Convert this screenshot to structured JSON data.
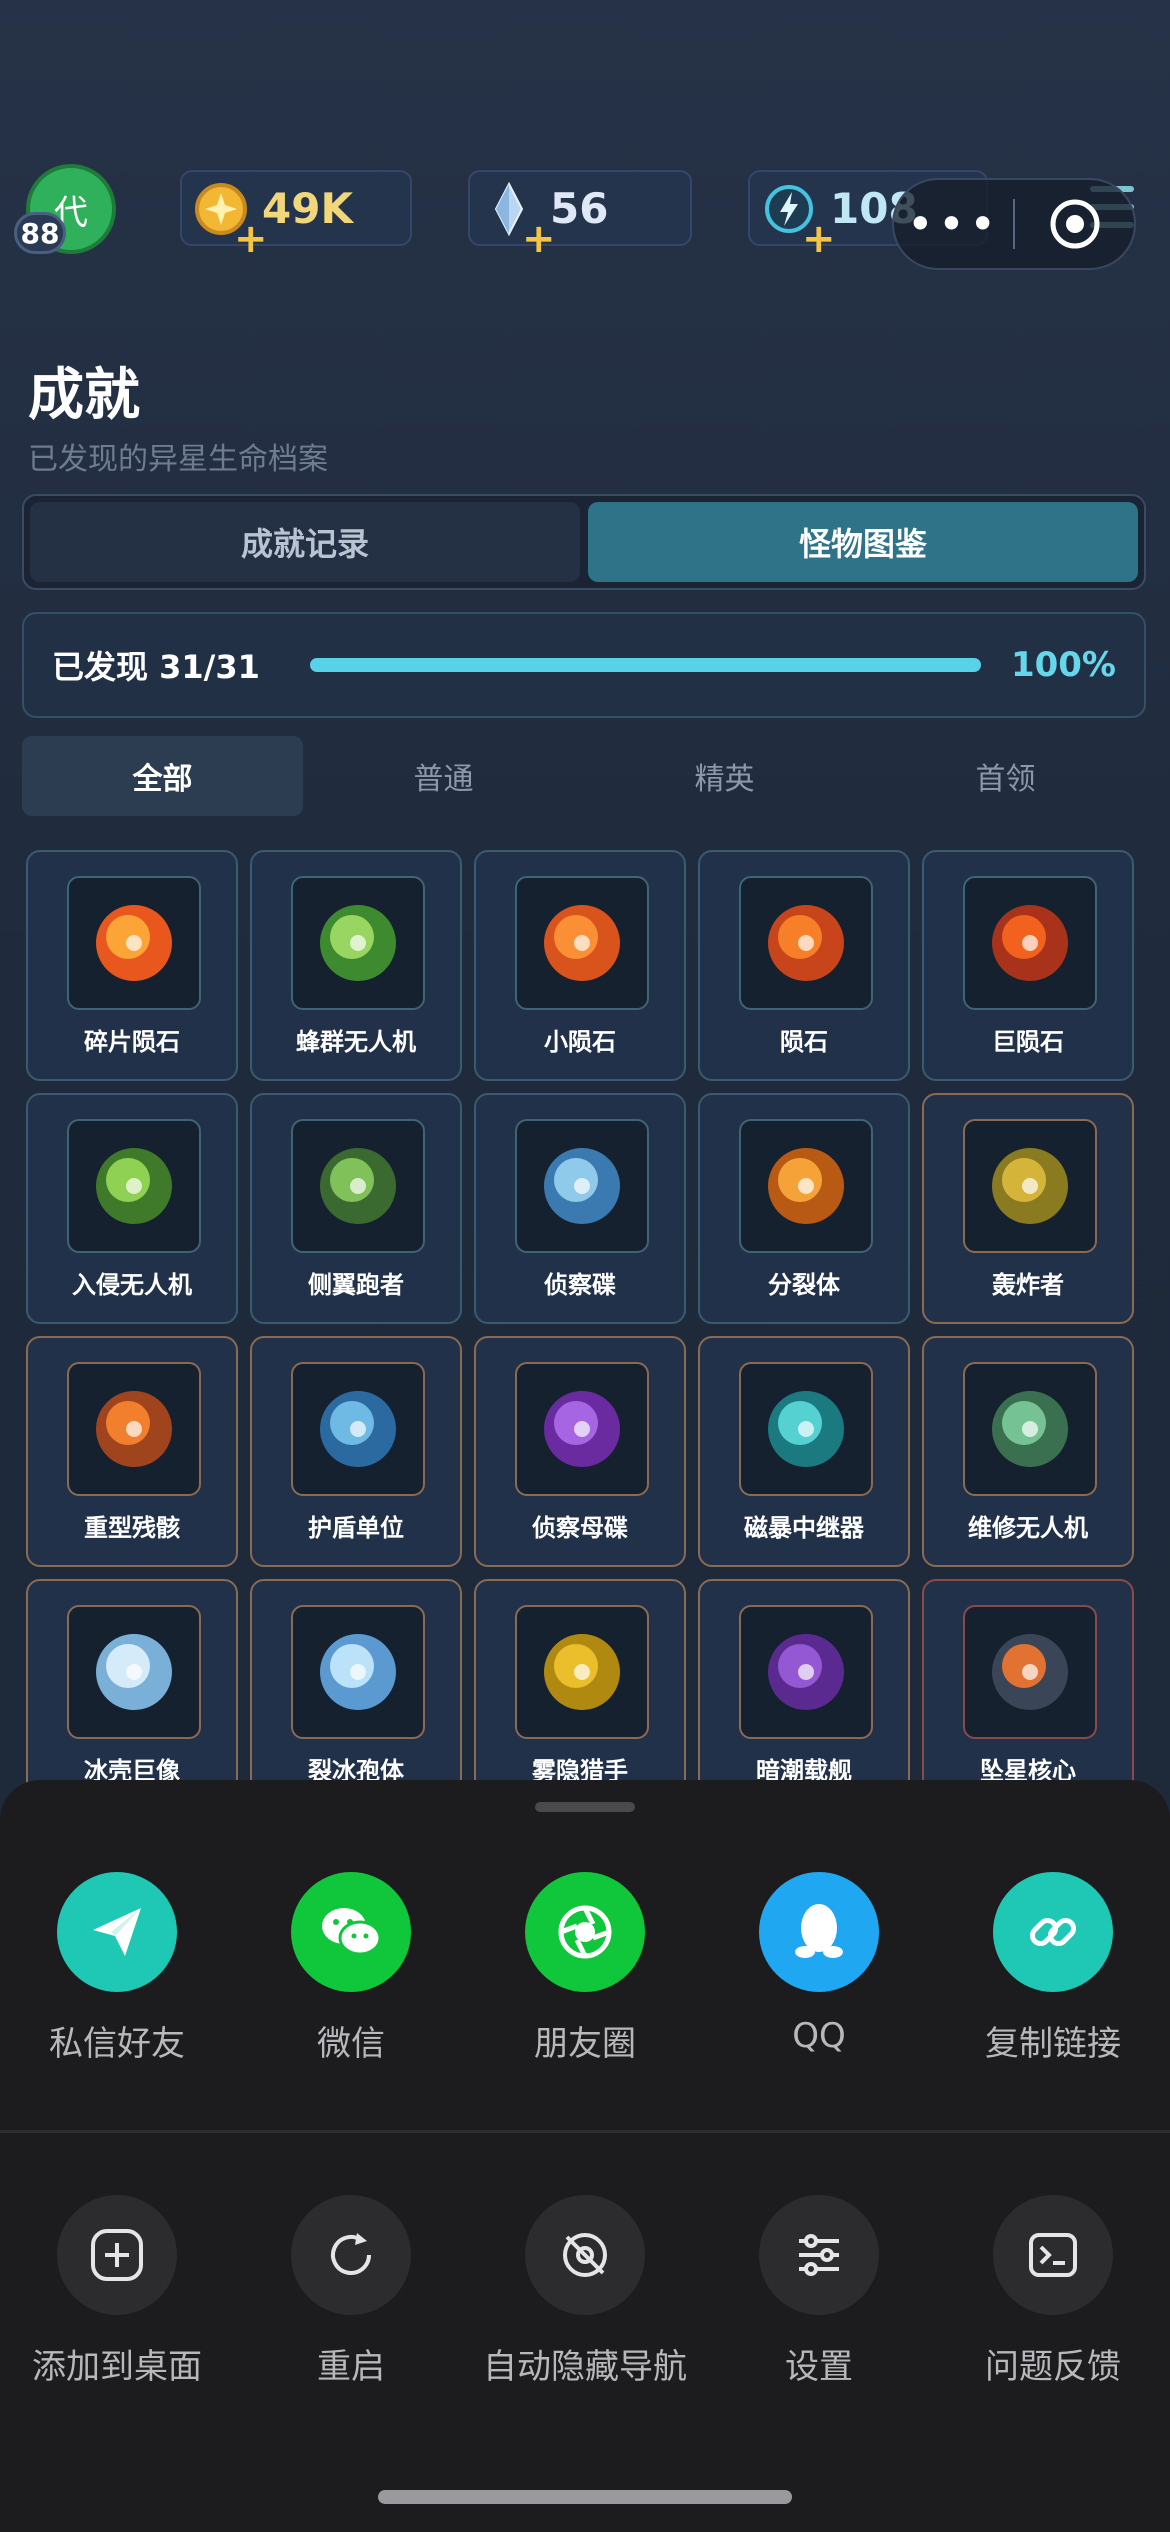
{
  "header": {
    "avatar_char": "代",
    "level": "88",
    "gold": "49K",
    "gems": "56",
    "energy": "108",
    "capsule_dots": "•••"
  },
  "page": {
    "title": "成就",
    "subtitle": "已发现的异星生命档案"
  },
  "tabs": [
    {
      "label": "成就记录",
      "active": false
    },
    {
      "label": "怪物图鉴",
      "active": true
    }
  ],
  "progress": {
    "label": "已发现 31/31",
    "fraction": 1.0,
    "percent_text": "100%"
  },
  "filters": [
    {
      "label": "全部",
      "active": true
    },
    {
      "label": "普通",
      "active": false
    },
    {
      "label": "精英",
      "active": false
    },
    {
      "label": "首领",
      "active": false
    }
  ],
  "monsters": [
    {
      "name": "碎片陨石",
      "icon": "meteor-fragment-icon",
      "tier": "normal"
    },
    {
      "name": "蜂群无人机",
      "icon": "swarm-drone-icon",
      "tier": "normal"
    },
    {
      "name": "小陨石",
      "icon": "small-meteor-icon",
      "tier": "normal"
    },
    {
      "name": "陨石",
      "icon": "meteor-icon",
      "tier": "normal"
    },
    {
      "name": "巨陨石",
      "icon": "giant-meteor-icon",
      "tier": "normal"
    },
    {
      "name": "入侵无人机",
      "icon": "invader-drone-icon",
      "tier": "normal"
    },
    {
      "name": "侧翼跑者",
      "icon": "flank-runner-icon",
      "tier": "normal"
    },
    {
      "name": "侦察碟",
      "icon": "scout-saucer-icon",
      "tier": "normal"
    },
    {
      "name": "分裂体",
      "icon": "splitter-icon",
      "tier": "normal"
    },
    {
      "name": "轰炸者",
      "icon": "bomber-icon",
      "tier": "elite"
    },
    {
      "name": "重型残骸",
      "icon": "heavy-wreck-icon",
      "tier": "elite"
    },
    {
      "name": "护盾单位",
      "icon": "shield-unit-icon",
      "tier": "elite"
    },
    {
      "name": "侦察母碟",
      "icon": "mothership-icon",
      "tier": "elite"
    },
    {
      "name": "磁暴中继器",
      "icon": "magnetic-relay-icon",
      "tier": "elite"
    },
    {
      "name": "维修无人机",
      "icon": "repair-drone-icon",
      "tier": "elite"
    },
    {
      "name": "冰壳巨像",
      "icon": "ice-colossus-icon",
      "tier": "elite"
    },
    {
      "name": "裂冰孢体",
      "icon": "ice-spore-icon",
      "tier": "elite"
    },
    {
      "name": "雾隐猎手",
      "icon": "mist-hunter-icon",
      "tier": "elite"
    },
    {
      "name": "暗潮载舰",
      "icon": "dark-carrier-icon",
      "tier": "elite"
    },
    {
      "name": "坠星核心",
      "icon": "fallen-star-core-icon",
      "tier": "boss"
    }
  ],
  "share_row": [
    {
      "label": "私信好友",
      "icon": "paper-plane-icon",
      "color": "#1fc8b4"
    },
    {
      "label": "微信",
      "icon": "wechat-icon",
      "color": "#10c63a"
    },
    {
      "label": "朋友圈",
      "icon": "moments-icon",
      "color": "#10c63a"
    },
    {
      "label": "QQ",
      "icon": "qq-penguin-icon",
      "color": "#1fa7f2"
    },
    {
      "label": "复制链接",
      "icon": "link-icon",
      "color": "#1fc8b4"
    }
  ],
  "action_row": [
    {
      "label": "添加到桌面",
      "icon": "add-square-icon"
    },
    {
      "label": "重启",
      "icon": "restart-icon"
    },
    {
      "label": "自动隐藏导航",
      "icon": "hide-nav-icon"
    },
    {
      "label": "设置",
      "icon": "sliders-icon"
    },
    {
      "label": "问题反馈",
      "icon": "terminal-icon"
    }
  ]
}
